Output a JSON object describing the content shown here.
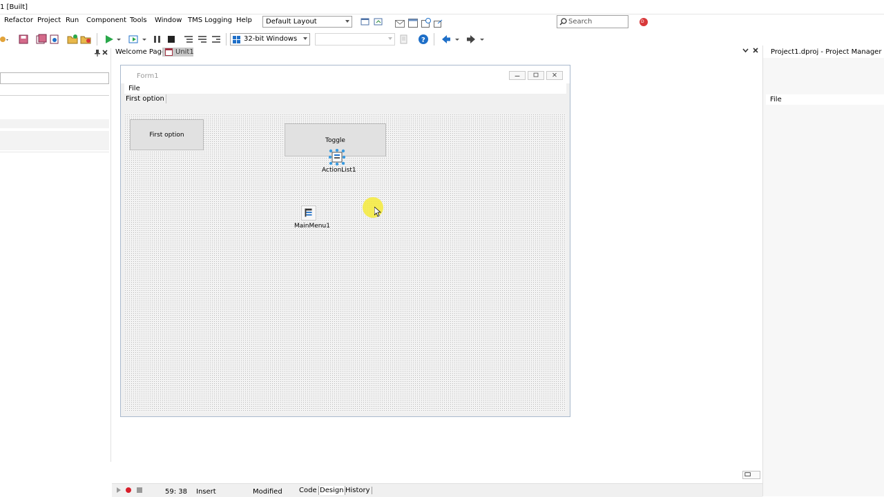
{
  "title_bar": {
    "text": "1 [Built]"
  },
  "menu": [
    {
      "label": "Refactor"
    },
    {
      "label": "Project"
    },
    {
      "label": "Run"
    },
    {
      "label": "Component"
    },
    {
      "label": "Tools"
    },
    {
      "label": "Window"
    },
    {
      "label": "TMS Logging"
    },
    {
      "label": "Help"
    }
  ],
  "layout_combo": {
    "value": "Default Layout"
  },
  "search": {
    "placeholder": "Search"
  },
  "platform_combo": {
    "value": "32-bit Windows"
  },
  "editor_tabs": [
    {
      "label": "Welcome Page"
    },
    {
      "label": "Unit1"
    }
  ],
  "form": {
    "title": "Form1",
    "menu_file": "File",
    "toolbar_button": "First option",
    "button_first": "First option",
    "button_toggle": "Toggle",
    "components": [
      {
        "label": "ActionList1"
      },
      {
        "label": "MainMenu1"
      }
    ]
  },
  "right_panel": {
    "title": "Project1.dproj - Project Manager",
    "item": "File"
  },
  "status": {
    "position": "59: 38",
    "mode": "Insert",
    "state": "Modified",
    "tabs": [
      {
        "label": "Code"
      },
      {
        "label": "Design"
      },
      {
        "label": "History"
      }
    ]
  },
  "colors": {
    "accent": "#1e6fc8",
    "play": "#2aa84a",
    "cursor_highlight": "#f5ea3a"
  }
}
